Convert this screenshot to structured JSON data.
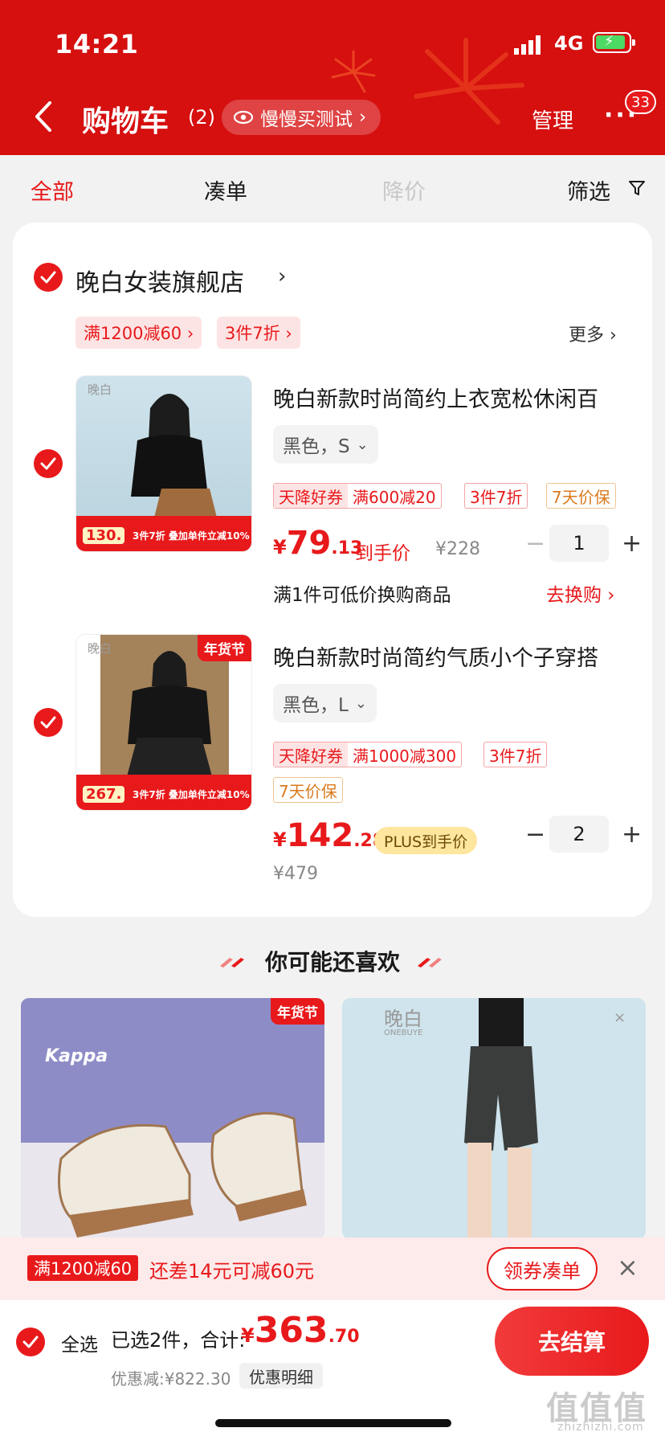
{
  "status": {
    "time": "14:21",
    "network": "4G"
  },
  "nav": {
    "title": "购物车",
    "count": "(2)",
    "pill_label": "慢慢买测试",
    "manage": "管理",
    "more_badge": "33"
  },
  "tabs": [
    {
      "label": "全部",
      "state": "active"
    },
    {
      "label": "凑单",
      "state": "normal"
    },
    {
      "label": "降价",
      "state": "disabled"
    },
    {
      "label": "筛选",
      "state": "normal"
    }
  ],
  "store": {
    "name": "晚白女装旗舰店",
    "promos": [
      "满1200减60 ›",
      "3件7折 ›"
    ],
    "more": "更多 ›"
  },
  "items": [
    {
      "brand": "晚白",
      "ribbon_price": "130.",
      "ribbon_text": "3件7折 叠加单件立减10%",
      "title": "晚白新款时尚简约上衣宽松休闲百",
      "sku": "黑色，S",
      "tags": [
        {
          "hl": "天降好券",
          "text": "满600减20"
        },
        {
          "text": "3件7折"
        },
        {
          "text": "7天价保"
        }
      ],
      "price_int": "79",
      "price_dec": ".13",
      "price_label": "到手价",
      "orig_price": "¥228",
      "qty": "1",
      "exchange": "满1件可低价换购商品",
      "exchange_link": "去换购 ›"
    },
    {
      "brand": "晚白",
      "badge": "年货节",
      "ribbon_price": "267.",
      "ribbon_text": "3件7折 叠加单件立减10%",
      "title": "晚白新款时尚简约气质小个子穿搭",
      "sku": "黑色，L",
      "tags": [
        {
          "hl": "天降好券",
          "text": "满1000减300"
        },
        {
          "text": "3件7折"
        },
        {
          "text": "7天价保"
        }
      ],
      "price_int": "142",
      "price_dec": ".28",
      "price_label": "PLUS到手价",
      "orig_price": "¥479",
      "qty": "2"
    }
  ],
  "recommend": {
    "title": "你可能还喜欢",
    "cards": [
      {
        "brand": "Kappa",
        "badge": "年货节"
      },
      {
        "brand": "晚白",
        "brand_sub": "ONEBUYE"
      }
    ]
  },
  "coupon": {
    "tag": "满1200减60",
    "text": "还差14元可减60元",
    "button": "领券凑单",
    "close": "×"
  },
  "bottom": {
    "select_all": "全选",
    "summary": "已选2件，合计:",
    "yen": "¥",
    "total_int": "363",
    "total_dec": ".70",
    "discount": "优惠减:¥822.30",
    "detail": "优惠明细",
    "checkout": "去结算"
  },
  "watermark": {
    "main": "值值值",
    "sub": "zhizhizhi.com"
  },
  "colors": {
    "brand_red": "#e8191b",
    "header_red": "#d60f0f",
    "plus_gold": "#ffe69e"
  }
}
